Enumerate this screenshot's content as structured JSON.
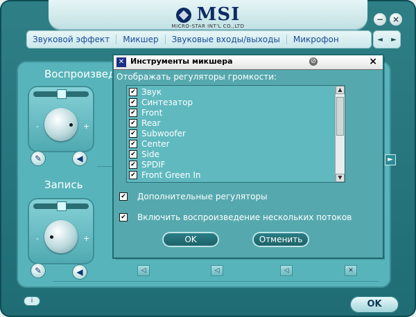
{
  "brand": {
    "name": "MSI",
    "tagline": "MICRO-STAR INT'L CO.,LTD"
  },
  "window": {
    "minimize_glyph": "−",
    "close_glyph": "×"
  },
  "tabs": [
    "Звуковой эффект",
    "Микшер",
    "Звуковые входы/выходы",
    "Микрофон"
  ],
  "nav": {
    "prev": "◄",
    "next": "►"
  },
  "main": {
    "playback_label": "Воспроизведе",
    "record_label": "Запись",
    "minus": "-",
    "plus": "+",
    "ok_label": "OK",
    "info_glyph": "i"
  },
  "dialog": {
    "title": "Инструменты микшера",
    "prompt": "Отображать регуляторы громкости:",
    "close_glyph": "×",
    "items": [
      {
        "label": "Звук",
        "checked": true
      },
      {
        "label": "Синтезатор",
        "checked": true
      },
      {
        "label": "Front",
        "checked": true
      },
      {
        "label": "Rear",
        "checked": true
      },
      {
        "label": "Subwoofer",
        "checked": true
      },
      {
        "label": "Center",
        "checked": true
      },
      {
        "label": "Side",
        "checked": true
      },
      {
        "label": "SPDIF",
        "checked": true
      },
      {
        "label": "Front Green In",
        "checked": true
      }
    ],
    "option_advanced": "Дополнительные регуляторы",
    "option_multistream": "Включить воспроизведение нескольких потоков",
    "ok": "OK",
    "cancel": "Отменить"
  }
}
